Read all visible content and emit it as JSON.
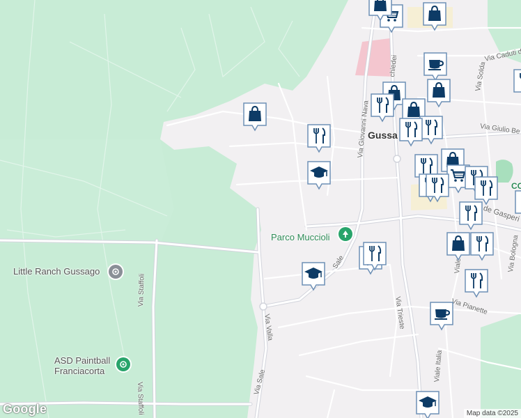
{
  "map": {
    "colors": {
      "park": "#c8ecd6",
      "park_dark": "#a8dfbd",
      "urban": "#f2f0f2",
      "road": "#ffffff",
      "road_outline": "#d5d5dc",
      "marker_fill": "#0d3b66",
      "marker_bg": "#ffffff",
      "marker_border": "#6d8fb5",
      "poi_green": "#28a46b",
      "poi_gray": "#8a8f97",
      "hospital_pink": "#f4c6cf"
    },
    "places": [
      {
        "id": "little-ranch",
        "label": "Little Ranch Gussago",
        "icon": "recreation-icon"
      },
      {
        "id": "asd-paintball",
        "label": "ASD Paintball Franciacorta",
        "lines": [
          "ASD Paintball",
          "Franciacorta"
        ],
        "icon": "park-icon"
      },
      {
        "id": "parco-muccioli",
        "label": "Parco Muccioli",
        "icon": "tree-icon"
      }
    ],
    "town": {
      "label": "Gussa"
    },
    "streets": [
      {
        "id": "via-staffoli-1",
        "label": "Via Staffoli"
      },
      {
        "id": "via-staffoli-2",
        "label": "Via Staffoli"
      },
      {
        "id": "via-valla",
        "label": "Via Valla"
      },
      {
        "id": "via-sale-1",
        "label": "Via Sale"
      },
      {
        "id": "via-sale-2",
        "label": "Sale"
      },
      {
        "id": "via-trieste",
        "label": "Via Trieste"
      },
      {
        "id": "via-giovanni-nava",
        "label": "Via Giovanni Nava"
      },
      {
        "id": "via-pianette",
        "label": "Via Pianette"
      },
      {
        "id": "viale-italia-1",
        "label": "Viale Italia"
      },
      {
        "id": "viale-italia-2",
        "label": "Viale It"
      },
      {
        "id": "via-bologna",
        "label": "Via Bologna"
      },
      {
        "id": "via-solda",
        "label": "Via Solda"
      },
      {
        "id": "via-caduti",
        "label": "Via Caduti d"
      },
      {
        "id": "via-giulio-be",
        "label": "Via Giulio Be"
      },
      {
        "id": "de-gasperi",
        "label": "de Gasperi"
      },
      {
        "id": "via-chiedei",
        "label": "chiedei"
      },
      {
        "id": "co",
        "label": "CO"
      }
    ],
    "markers": [
      {
        "id": "m1",
        "icon": "shopping-cart-icon"
      },
      {
        "id": "m2",
        "icon": "shopping-bag-icon"
      },
      {
        "id": "m3",
        "icon": "shopping-bag-icon"
      },
      {
        "id": "m4",
        "icon": "coffee-cup-icon"
      },
      {
        "id": "m5",
        "icon": "restaurant-icon"
      },
      {
        "id": "m6",
        "icon": "shopping-bag-icon"
      },
      {
        "id": "m7",
        "icon": "shopping-bag-icon"
      },
      {
        "id": "m8",
        "icon": "shopping-bag-icon"
      },
      {
        "id": "m9",
        "icon": "restaurant-icon"
      },
      {
        "id": "m10",
        "icon": "restaurant-icon"
      },
      {
        "id": "m11",
        "icon": "restaurant-icon"
      },
      {
        "id": "m12",
        "icon": "school-icon"
      },
      {
        "id": "m13",
        "icon": "restaurant-icon"
      },
      {
        "id": "m14",
        "icon": "shopping-bag-icon"
      },
      {
        "id": "m15",
        "icon": "shopping-cart-icon"
      },
      {
        "id": "m16",
        "icon": "restaurant-icon"
      },
      {
        "id": "m17",
        "icon": "restaurant-icon"
      },
      {
        "id": "m18",
        "icon": "restaurant-icon"
      },
      {
        "id": "m19",
        "icon": "restaurant-icon"
      },
      {
        "id": "m20",
        "icon": "restaurant-icon"
      },
      {
        "id": "m21",
        "icon": "shopping-bag-icon"
      },
      {
        "id": "m22",
        "icon": "restaurant-icon"
      },
      {
        "id": "m23",
        "icon": "restaurant-icon"
      },
      {
        "id": "m24",
        "icon": "school-icon"
      },
      {
        "id": "m25",
        "icon": "restaurant-icon"
      },
      {
        "id": "m26",
        "icon": "coffee-cup-icon"
      },
      {
        "id": "m27",
        "icon": "school-icon"
      },
      {
        "id": "m28",
        "icon": "coffee-cup-icon"
      }
    ],
    "logo": "Google",
    "attribution": "Map data ©2025"
  }
}
